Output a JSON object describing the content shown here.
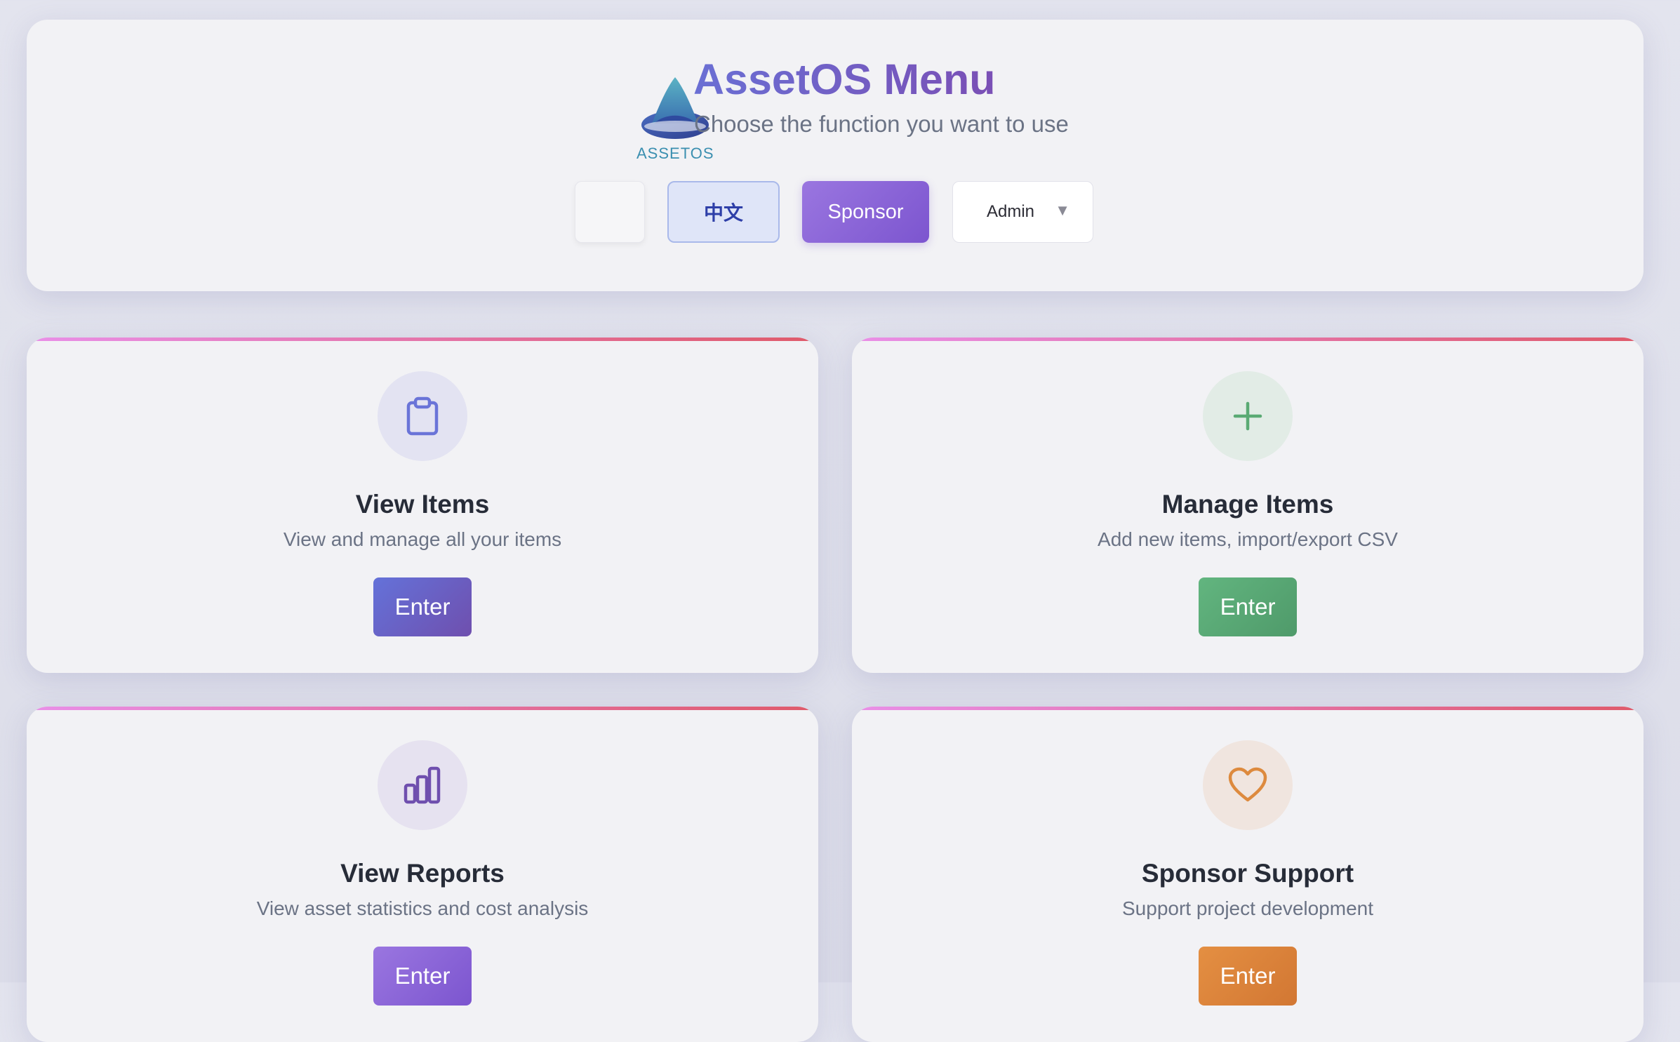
{
  "header": {
    "logo_text": "ASSETOS",
    "title": "AssetOS Menu",
    "subtitle": "Choose the function you want to use",
    "theme_button_label": "",
    "language_button_label": "中文",
    "sponsor_button_label": "Sponsor",
    "user_select_value": "Admin"
  },
  "cards": [
    {
      "icon": "clipboard-icon",
      "title": "View Items",
      "description": "View and manage all your items",
      "button_label": "Enter",
      "accent": "#6a5fcb"
    },
    {
      "icon": "plus-icon",
      "title": "Manage Items",
      "description": "Add new items, import/export CSV",
      "button_label": "Enter",
      "accent": "#5aaa74"
    },
    {
      "icon": "bar-chart-icon",
      "title": "View Reports",
      "description": "View asset statistics and cost analysis",
      "button_label": "Enter",
      "accent": "#8a64d6"
    },
    {
      "icon": "heart-icon",
      "title": "Sponsor Support",
      "description": "Support project development",
      "button_label": "Enter",
      "accent": "#dd8a3e"
    }
  ],
  "colors": {
    "title_gradient_start": "#6a6fd4",
    "title_gradient_end": "#7a4fb5",
    "card_top_border_start": "#e98fe8",
    "card_top_border_end": "#df5a6a"
  }
}
